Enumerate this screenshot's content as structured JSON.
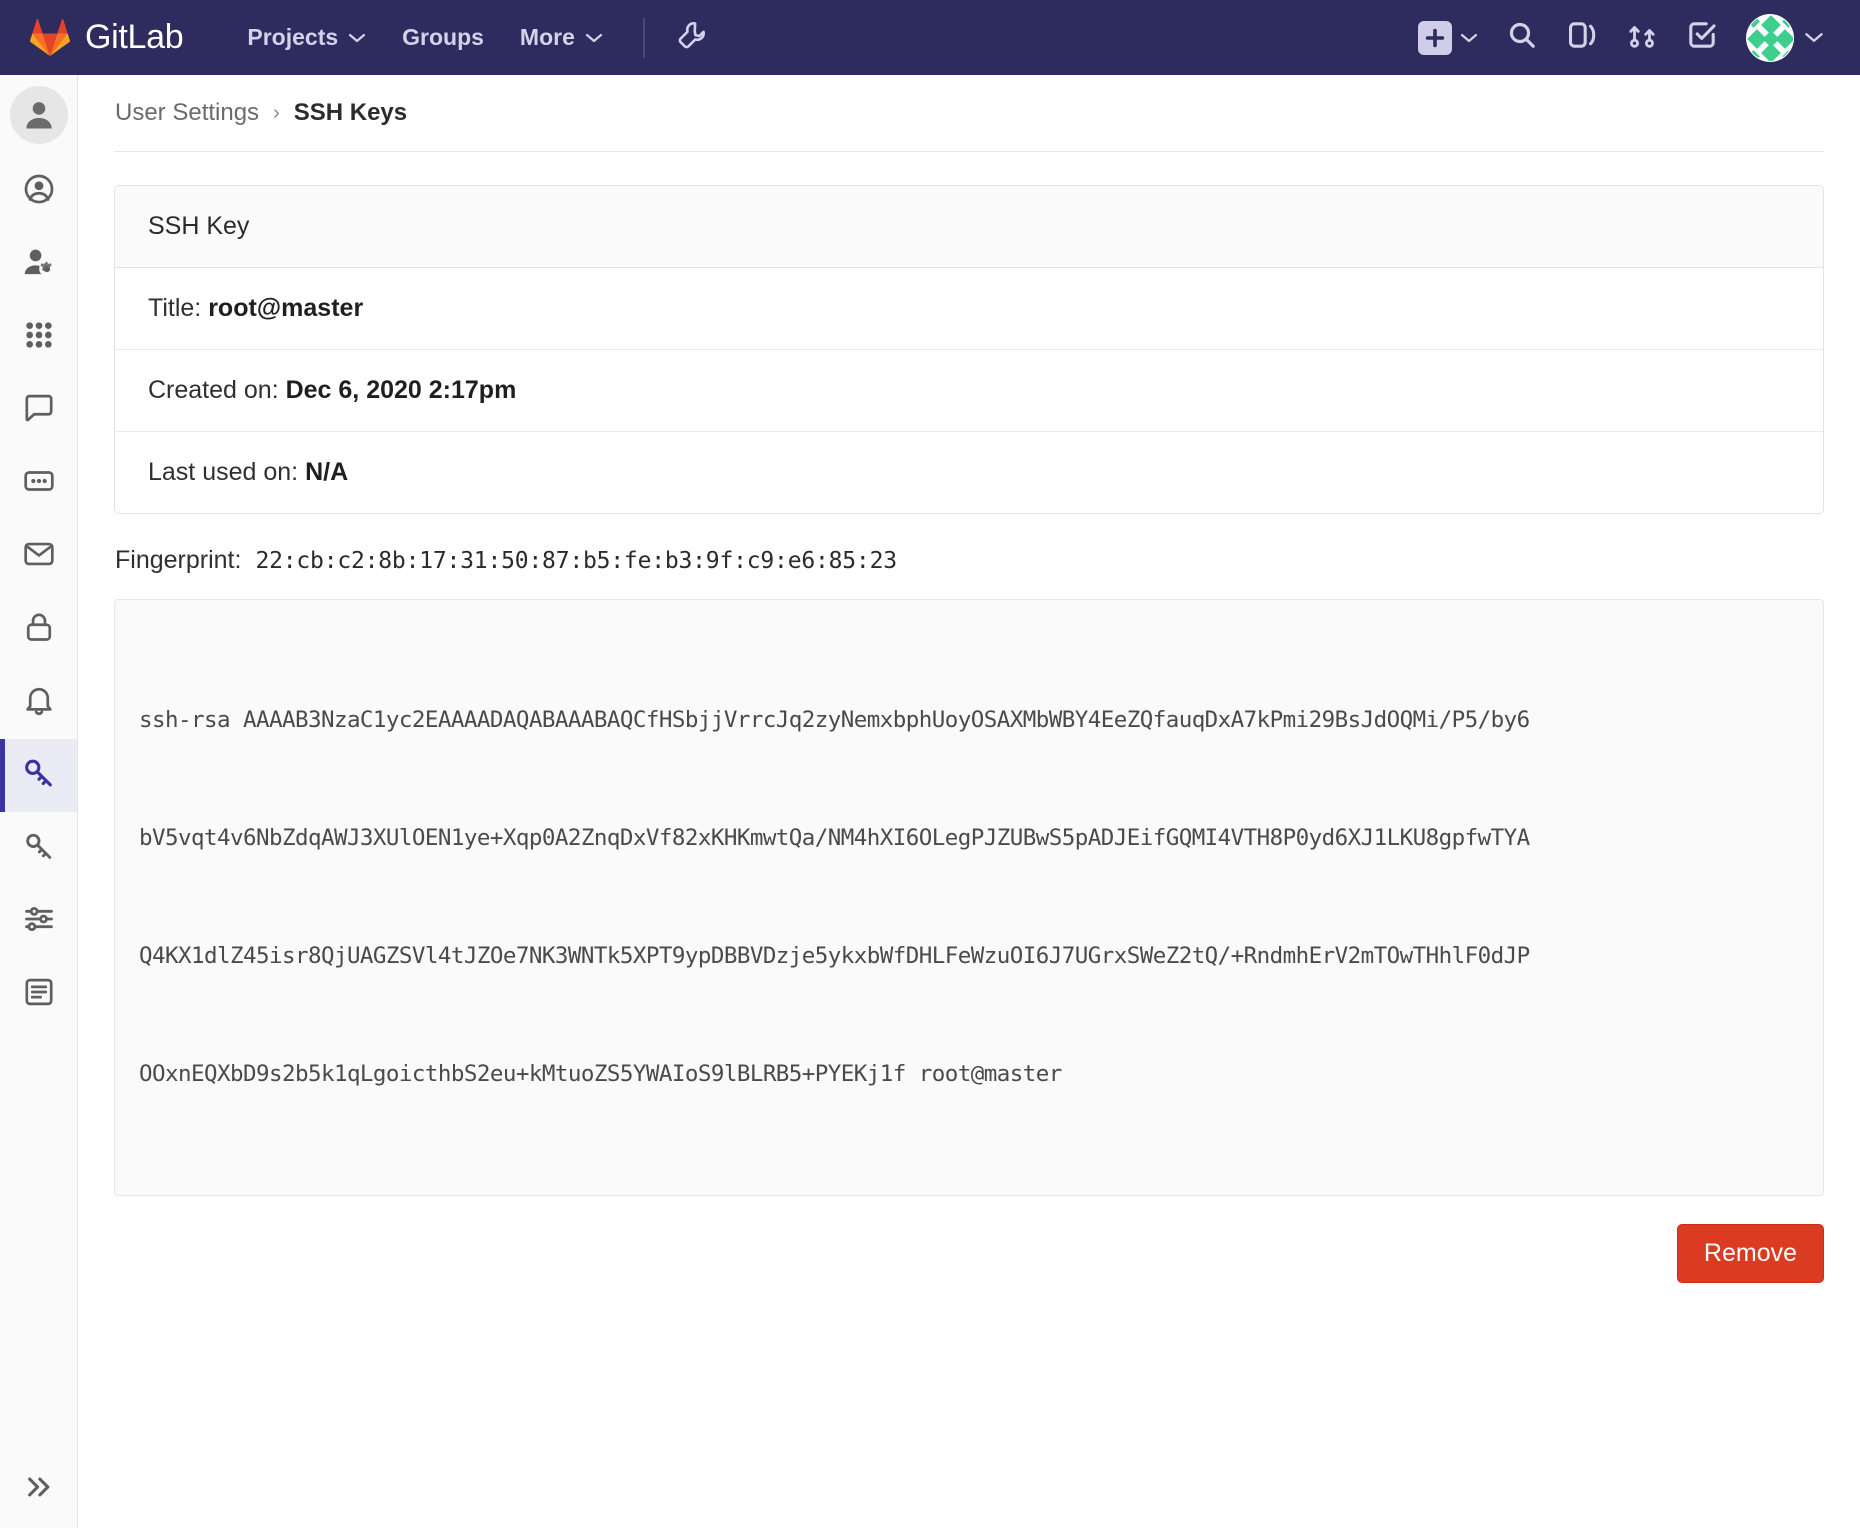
{
  "navbar": {
    "brand": "GitLab",
    "logo_icon": "gitlab-logo-icon",
    "links": [
      {
        "label": "Projects",
        "has_caret": true
      },
      {
        "label": "Groups",
        "has_caret": false
      },
      {
        "label": "More",
        "has_caret": true
      }
    ],
    "admin_icon": "wrench-icon",
    "right_icons": [
      {
        "name": "plus-square-icon",
        "has_caret": true
      },
      {
        "name": "search-icon",
        "has_caret": false
      },
      {
        "name": "issues-icon",
        "has_caret": false
      },
      {
        "name": "merge-request-icon",
        "has_caret": false
      },
      {
        "name": "todos-checkmark-icon",
        "has_caret": false
      }
    ],
    "avatar": {
      "name": "user-avatar",
      "has_caret": true
    }
  },
  "sidebar": {
    "profile_avatar": "profile-avatar-icon",
    "items": [
      {
        "name": "sidebar-item-profile",
        "icon": "user-circle-icon",
        "active": false
      },
      {
        "name": "sidebar-item-account",
        "icon": "user-gear-icon",
        "active": false
      },
      {
        "name": "sidebar-item-applications",
        "icon": "grid-apps-icon",
        "active": false
      },
      {
        "name": "sidebar-item-chat",
        "icon": "comment-icon",
        "active": false
      },
      {
        "name": "sidebar-item-access-tokens",
        "icon": "token-card-icon",
        "active": false
      },
      {
        "name": "sidebar-item-emails",
        "icon": "envelope-icon",
        "active": false
      },
      {
        "name": "sidebar-item-password",
        "icon": "lock-icon",
        "active": false
      },
      {
        "name": "sidebar-item-notifications",
        "icon": "bell-icon",
        "active": false
      },
      {
        "name": "sidebar-item-ssh-keys",
        "icon": "key-icon",
        "active": true
      },
      {
        "name": "sidebar-item-gpg-keys",
        "icon": "key-outline-icon",
        "active": false
      },
      {
        "name": "sidebar-item-preferences",
        "icon": "sliders-icon",
        "active": false
      },
      {
        "name": "sidebar-item-active-sessions",
        "icon": "list-icon",
        "active": false
      }
    ],
    "expand_icon": "chevron-double-right-icon"
  },
  "breadcrumb": {
    "parent": "User Settings",
    "separator": "›",
    "current": "SSH Keys"
  },
  "ssh_key": {
    "card_title": "SSH Key",
    "rows": [
      {
        "label": "Title:",
        "value": "root@master"
      },
      {
        "label": "Created on:",
        "value": "Dec 6, 2020 2:17pm"
      },
      {
        "label": "Last used on:",
        "value": "N/A"
      }
    ],
    "fingerprint_label": "Fingerprint:",
    "fingerprint_value": "22:cb:c2:8b:17:31:50:87:b5:fe:b3:9f:c9:e6:85:23",
    "key_lines": [
      "ssh-rsa AAAAB3NzaC1yc2EAAAADAQABAAABAQCfHSbjjVrrcJq2zyNemxbphUoyOSAXMbWBY4EeZQfauqDxA7kPmi29BsJdOQMi/P5/by6",
      "bV5vqt4v6NbZdqAWJ3XUlOEN1ye+Xqp0A2ZnqDxVf82xKHKmwtQa/NM4hXI6OLegPJZUBwS5pADJEifGQMI4VTH8P0yd6XJ1LKU8gpfwTYA",
      "Q4KX1dlZ45isr8QjUAGZSVl4tJZOe7NK3WNTk5XPT9ypDBBVDzje5ykxbWfDHLFeWzuOI6J7UGrxSWeZ2tQ/+RndmhErV2mTOwTHhlF0dJP",
      "OOxnEQXbD9s2b5k1qLgoicthbS2eu+kMtuoZS5YWAIoS9lBLRB5+PYEKj1f root@master"
    ],
    "remove_label": "Remove"
  },
  "colors": {
    "navbar_bg": "#2e2b5f",
    "accent": "#3a34a3",
    "danger": "#db3b21",
    "rail_bg": "#fafafa"
  }
}
